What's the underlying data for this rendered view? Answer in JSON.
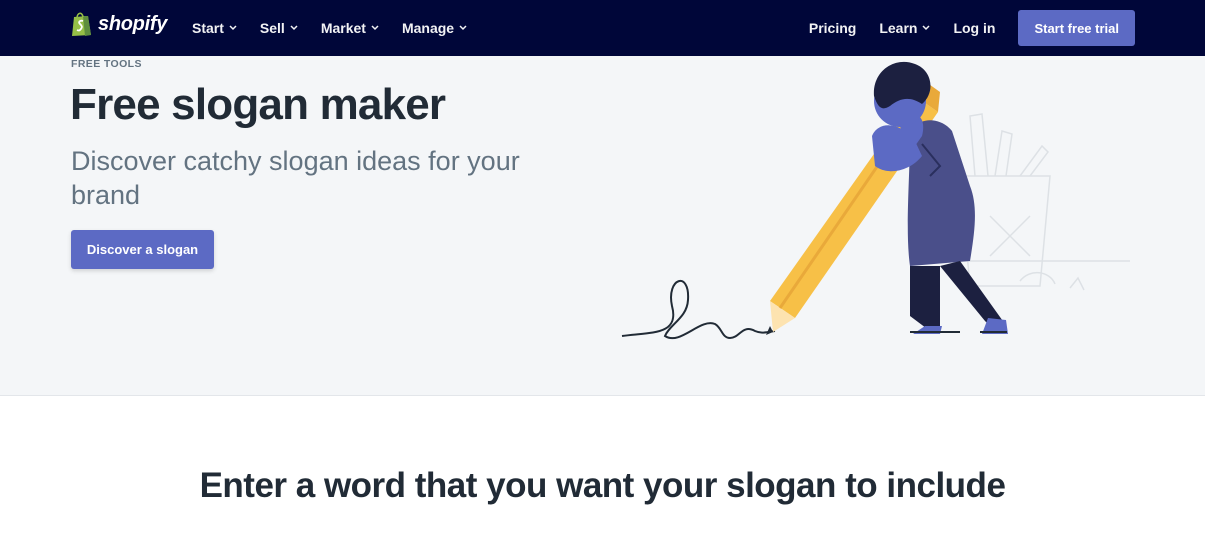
{
  "brand": {
    "name": "shopify"
  },
  "nav": {
    "left": [
      {
        "label": "Start"
      },
      {
        "label": "Sell"
      },
      {
        "label": "Market"
      },
      {
        "label": "Manage"
      }
    ],
    "pricing": "Pricing",
    "learn": "Learn",
    "login": "Log in",
    "cta": "Start free trial"
  },
  "hero": {
    "eyebrow": "FREE TOOLS",
    "title": "Free slogan maker",
    "subtitle": "Discover catchy slogan ideas for your brand",
    "button": "Discover a slogan"
  },
  "section": {
    "title": "Enter a word that you want your slogan to include"
  },
  "colors": {
    "nav_bg": "#000639",
    "accent": "#5c6ac4",
    "hero_bg": "#f4f6f8",
    "pencil": "#f7c047",
    "figure": "#5c6ac4"
  }
}
